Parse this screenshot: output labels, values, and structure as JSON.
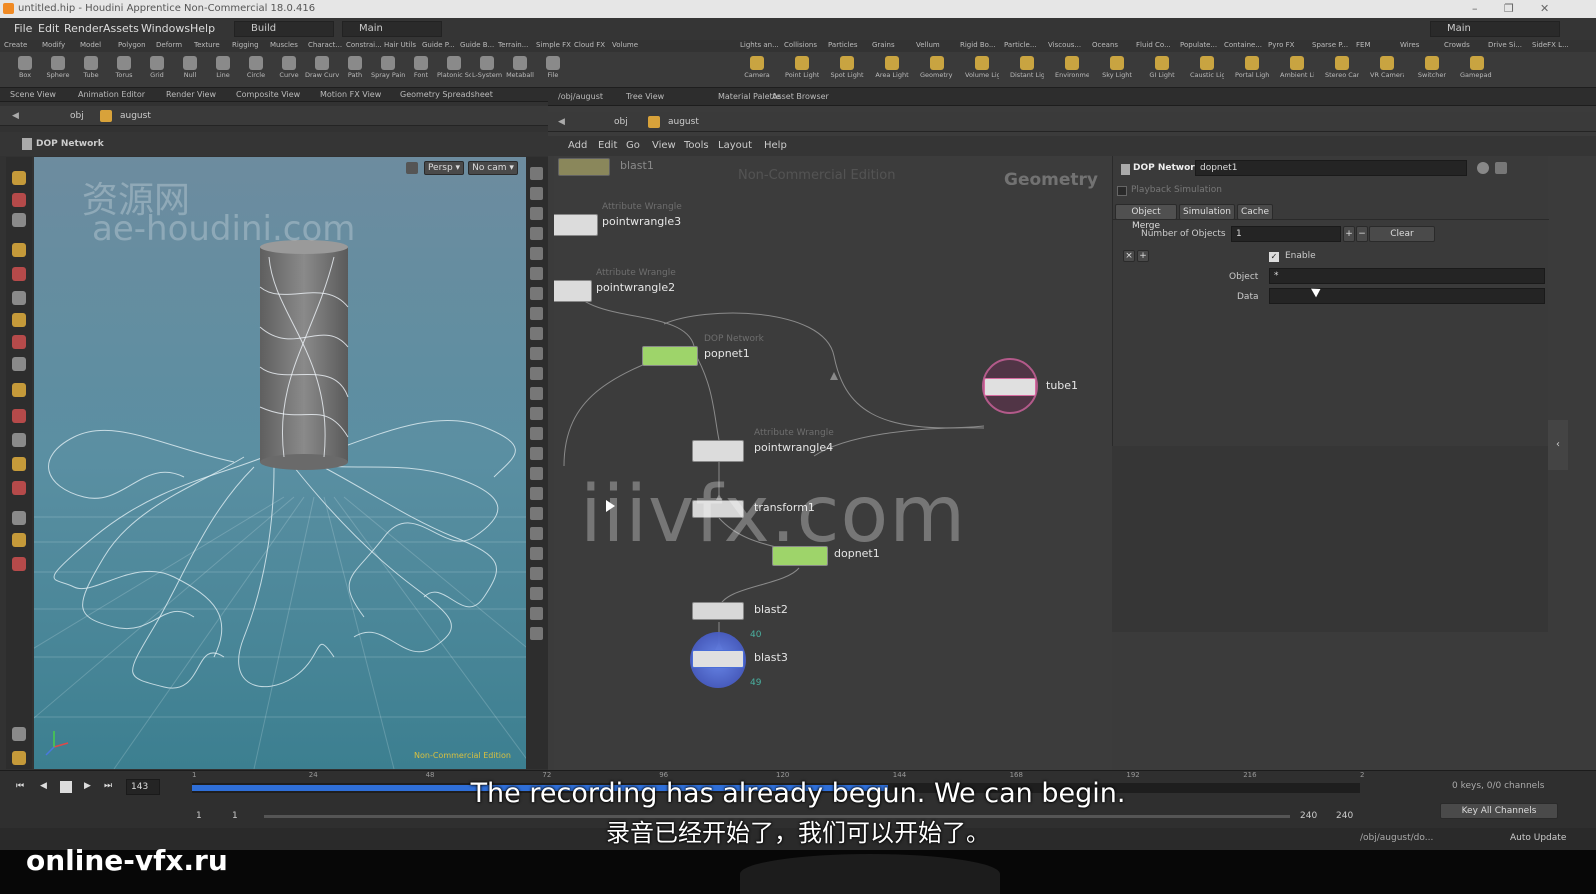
{
  "window": {
    "title": "untitled.hip - Houdini Apprentice Non-Commercial 18.0.416",
    "controls": [
      "–",
      "❐",
      "✕"
    ]
  },
  "menubar": {
    "items": [
      "File",
      "Edit",
      "Render",
      "Assets",
      "Windows",
      "Help"
    ],
    "desktop_build": "Build",
    "desktop_main": "Main",
    "right_desktop": "Main"
  },
  "shelf": {
    "left_tabs": [
      "Create",
      "Modify",
      "Model",
      "Polygon",
      "Deform",
      "Texture",
      "Rigging",
      "Muscles",
      "Charact...",
      "Constrai...",
      "Hair Utils",
      "Guide P...",
      "Guide B...",
      "Terrain...",
      "Simple FX",
      "Cloud FX",
      "Volume"
    ],
    "right_tabs": [
      "Lights an...",
      "Collisions",
      "Particles",
      "Grains",
      "Vellum",
      "Rigid Bo...",
      "Particle...",
      "Viscous...",
      "Oceans",
      "Fluid Co...",
      "Populate...",
      "Containe...",
      "Pyro FX",
      "Sparse P...",
      "FEM",
      "Wires",
      "Crowds",
      "Drive Si...",
      "SideFX L..."
    ],
    "left_tools": [
      "Box",
      "Sphere",
      "Tube",
      "Torus",
      "Grid",
      "Null",
      "Line",
      "Circle",
      "Curve",
      "Draw Curve",
      "Path",
      "Spray Paint",
      "Font",
      "Platonic Solids",
      "L-System",
      "Metaball",
      "File"
    ],
    "right_tools": [
      "Camera",
      "Point Light",
      "Spot Light",
      "Area Light",
      "Geometry Light",
      "Volume Light",
      "Distant Light",
      "Environment Light",
      "Sky Light",
      "GI Light",
      "Caustic Light",
      "Portal Light",
      "Ambient Light",
      "Stereo Camera",
      "VR Camera",
      "Switcher",
      "Gamepad Camera"
    ]
  },
  "left_pane": {
    "tabs": [
      "Scene View",
      "Animation Editor",
      "Render View",
      "Composite View",
      "Motion FX View",
      "Geometry Spreadsheet"
    ],
    "path_obj": "obj",
    "path_august": "august",
    "title": "DOP Network",
    "persp": "Persp ▾",
    "cam": "No cam ▾",
    "watermark_cn": "资源网",
    "watermark_site": "ae-houdini.com",
    "nc_label": "Non-Commercial Edition"
  },
  "right_pane": {
    "tabs": [
      "/obj/august",
      "Tree View",
      "Material Palette",
      "Asset Browser"
    ],
    "path_obj": "obj",
    "path_august": "august",
    "menu": [
      "Add",
      "Edit",
      "Go",
      "View",
      "Tools",
      "Layout",
      "Help"
    ],
    "nc_label": "Non-Commercial Edition",
    "context": "Geometry"
  },
  "nodes": [
    {
      "type": "",
      "name": "blast1",
      "count": ""
    },
    {
      "type": "Attribute Wrangle",
      "name": "pointwrangle3",
      "count": ""
    },
    {
      "type": "Attribute Wrangle",
      "name": "pointwrangle2",
      "count": ""
    },
    {
      "type": "DOP Network",
      "name": "popnet1",
      "count": ""
    },
    {
      "type": "",
      "name": "tube1",
      "count": ""
    },
    {
      "type": "Attribute Wrangle",
      "name": "pointwrangle4",
      "count": ""
    },
    {
      "type": "",
      "name": "transform1",
      "count": ""
    },
    {
      "type": "",
      "name": "dopnet1",
      "count": ""
    },
    {
      "type": "",
      "name": "blast2",
      "count": "40"
    },
    {
      "type": "",
      "name": "blast3",
      "count": "49"
    }
  ],
  "parameters": {
    "op_type": "DOP Network",
    "op_name": "dopnet1",
    "playback": "Playback Simulation",
    "tabs": [
      "Object Merge",
      "Simulation",
      "Cache"
    ],
    "num_objects_label": "Number of Objects",
    "num_objects_value": "1",
    "clear_label": "Clear",
    "enable_label": "Enable",
    "object_label": "Object",
    "object_value": "*",
    "data_label": "Data",
    "data_value": ""
  },
  "timeline": {
    "current_frame": "143",
    "range_start": "1",
    "range_start2": "1",
    "range_end": "240",
    "range_end2": "240",
    "channels": "0 keys, 0/0 channels",
    "key_all": "Key All Channels",
    "path": "/obj/august/do...",
    "auto_update": "Auto Update",
    "ticks": [
      "1",
      "24",
      "48",
      "72",
      "96",
      "120",
      "144",
      "168",
      "192",
      "216",
      "2"
    ]
  },
  "overlay": {
    "site_watermark": "iiivfx.com",
    "bottom_watermark": "online-vfx.ru",
    "subtitle_en": "The recording has already begun. We can begin.",
    "subtitle_cn": "录音已经开始了，我们可以开始了。"
  },
  "colors": {
    "accent_orange": "#f08a24",
    "dop_green": "#9ed46a",
    "timeline_blue": "#2f6fd8",
    "tube_pink": "#d66aa0",
    "blast_blue": "#4a6ed8"
  }
}
